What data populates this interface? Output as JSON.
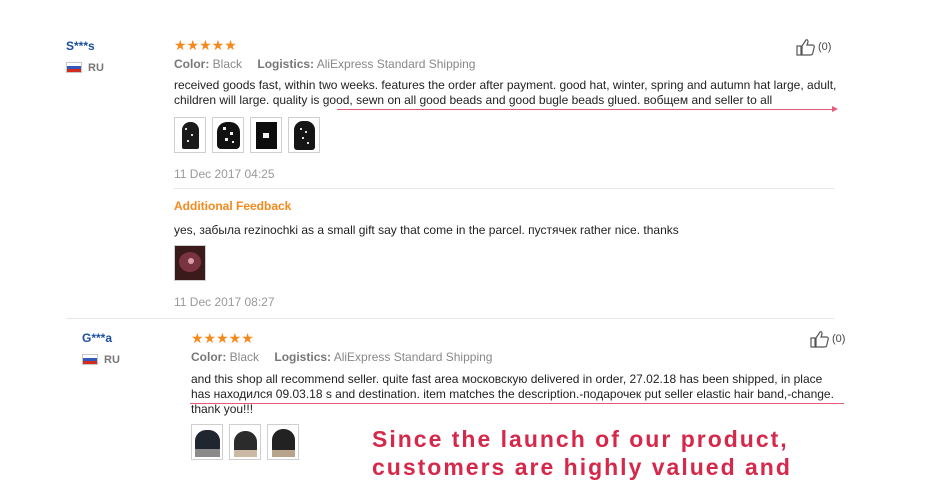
{
  "reviews": [
    {
      "user": "S***s",
      "country": "RU",
      "stars": "★★★★★",
      "color_label": "Color:",
      "color_value": "Black",
      "logistics_label": "Logistics:",
      "logistics_value": "AliExpress Standard Shipping",
      "helpful_count": "(0)",
      "text": "received goods fast, within two weeks. features the order after payment. good hat, winter, spring and autumn hat large, adult, children will large. quality is good, sewn on all good beads and good bugle beads glued. вобщем and seller to all",
      "date": "11 Dec 2017 04:25",
      "additional": {
        "title": "Additional Feedback",
        "text": "yes, забыла rezinochki as a small gift say that come in the parcel. пустячек rather nice. thanks",
        "date": "11 Dec 2017 08:27"
      }
    },
    {
      "user": "G***a",
      "country": "RU",
      "stars": "★★★★★",
      "color_label": "Color:",
      "color_value": "Black",
      "logistics_label": "Logistics:",
      "logistics_value": "AliExpress Standard Shipping",
      "helpful_count": "(0)",
      "text": "and this shop all recommend seller. quite fast area московскую delivered in order, 27.02.18 has been shipped, in place has находился 09.03.18 s and destination. item matches the description.-подарочек put seller elastic hair band,-change. thank you!!!"
    }
  ],
  "overlay": {
    "line1": "Since the launch of our product,",
    "line2": "customers are highly valued and"
  },
  "colors": {
    "accent_orange": "#f5891c",
    "username_blue": "#1a4fa0",
    "highlight_red": "#d6284a"
  }
}
